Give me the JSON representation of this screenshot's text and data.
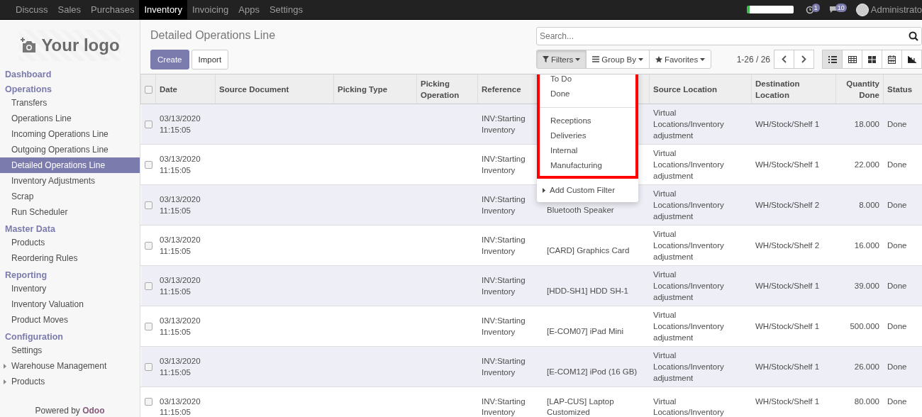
{
  "navbar": {
    "apps": [
      {
        "label": "Discuss",
        "selected": false
      },
      {
        "label": "Sales",
        "selected": false
      },
      {
        "label": "Purchases",
        "selected": false
      },
      {
        "label": "Inventory",
        "selected": true
      },
      {
        "label": "Invoicing",
        "selected": false
      },
      {
        "label": "Apps",
        "selected": false
      },
      {
        "label": "Settings",
        "selected": false
      }
    ],
    "activity_count": "1",
    "message_count": "10",
    "user": "Administrato"
  },
  "sidebar": {
    "logo": "Your logo",
    "sections": [
      {
        "title": "Dashboard"
      },
      {
        "title": "Operations",
        "items": [
          {
            "label": "Transfers",
            "selected": false
          },
          {
            "label": "Operations Line",
            "selected": false
          },
          {
            "label": "Incoming Operations Line",
            "selected": false
          },
          {
            "label": "Outgoing Operations Line",
            "selected": false
          },
          {
            "label": "Detailed Operations Line",
            "selected": true
          },
          {
            "label": "Inventory Adjustments",
            "selected": false
          },
          {
            "label": "Scrap",
            "selected": false
          },
          {
            "label": "Run Scheduler",
            "selected": false
          }
        ]
      },
      {
        "title": "Master Data",
        "items": [
          {
            "label": "Products",
            "selected": false
          },
          {
            "label": "Reordering Rules",
            "selected": false
          }
        ]
      },
      {
        "title": "Reporting",
        "items": [
          {
            "label": "Inventory",
            "selected": false
          },
          {
            "label": "Inventory Valuation",
            "selected": false
          },
          {
            "label": "Product Moves",
            "selected": false
          }
        ]
      },
      {
        "title": "Configuration",
        "items": [
          {
            "label": "Settings",
            "selected": false
          },
          {
            "label": "Warehouse Management",
            "selected": false,
            "expanded": false
          },
          {
            "label": "Products",
            "selected": false,
            "expanded": false
          }
        ]
      }
    ],
    "footer": "Powered by **Odoo**"
  },
  "control_panel": {
    "title": "Detailed Operations Line",
    "buttons": [
      "Create",
      "Import"
    ],
    "search": {
      "placeholder": "Search..."
    },
    "search_options": [
      {
        "label": "Filters",
        "selected": true
      },
      {
        "label": "Group By",
        "selected": false
      },
      {
        "label": "Favorites",
        "selected": false
      }
    ],
    "pager": "1-26 / 26",
    "views": [
      {
        "selected": true
      },
      {
        "selected": false
      },
      {
        "selected": false
      },
      {
        "selected": false
      },
      {
        "selected": false
      }
    ]
  },
  "filters_menu": {
    "groups": [
      [
        "To Do",
        "Done"
      ],
      [
        "Receptions",
        "Deliveries",
        "Internal",
        "Manufacturing"
      ]
    ],
    "custom": "Add Custom Filter"
  },
  "table": {
    "all_checked": false,
    "columns": [
      "Date",
      "Source Document",
      "Picking Type",
      "Picking Operation",
      "Reference",
      null,
      "Source Location",
      "Destination Location",
      "Quantity Done",
      "Status"
    ],
    "rows": [
      {
        "checked": false,
        "date": "03/13/2020 11:15:05",
        "reference": "INV:Starting Inventory",
        "source_location": "Virtual Locations/Inventory adjustment",
        "destination_location": "WH/Stock/Shelf 1",
        "quantity_done": "18.000",
        "status": "Done"
      },
      {
        "checked": false,
        "date": "03/13/2020 11:15:05",
        "reference": "INV:Starting Inventory",
        "source_location": "Virtual Locations/Inventory adjustment",
        "destination_location": "WH/Stock/Shelf 1",
        "quantity_done": "22.000",
        "status": "Done"
      },
      {
        "checked": false,
        "date": "03/13/2020 11:15:05",
        "reference": "INV:Starting Inventory",
        "product": "Bluetooth Speaker",
        "source_location": "Virtual Locations/Inventory adjustment",
        "destination_location": "WH/Stock/Shelf 2",
        "quantity_done": "8.000",
        "status": "Done"
      },
      {
        "checked": false,
        "date": "03/13/2020 11:15:05",
        "reference": "INV:Starting Inventory",
        "product": "[CARD] Graphics Card",
        "source_location": "Virtual Locations/Inventory adjustment",
        "destination_location": "WH/Stock/Shelf 2",
        "quantity_done": "16.000",
        "status": "Done"
      },
      {
        "checked": false,
        "date": "03/13/2020 11:15:05",
        "reference": "INV:Starting Inventory",
        "product": "[HDD-SH1] HDD SH-1",
        "source_location": "Virtual Locations/Inventory adjustment",
        "destination_location": "WH/Stock/Shelf 1",
        "quantity_done": "39.000",
        "status": "Done"
      },
      {
        "checked": false,
        "date": "03/13/2020 11:15:05",
        "reference": "INV:Starting Inventory",
        "product": "[E-COM07] iPad Mini",
        "source_location": "Virtual Locations/Inventory adjustment",
        "destination_location": "WH/Stock/Shelf 1",
        "quantity_done": "500.000",
        "status": "Done"
      },
      {
        "checked": false,
        "date": "03/13/2020 11:15:05",
        "reference": "INV:Starting Inventory",
        "product": "[E-COM12] iPod (16 GB)",
        "source_location": "Virtual Locations/Inventory adjustment",
        "destination_location": "WH/Stock/Shelf 1",
        "quantity_done": "26.000",
        "status": "Done"
      },
      {
        "checked": false,
        "date": "03/13/2020 11:15:05",
        "reference": "INV:Starting Inventory",
        "product": "[LAP-CUS] Laptop Customized",
        "source_location": "Virtual Locations/Inventory",
        "destination_location": "WH/Stock/Shelf 1",
        "quantity_done": "80.000",
        "status": "Done"
      }
    ]
  }
}
